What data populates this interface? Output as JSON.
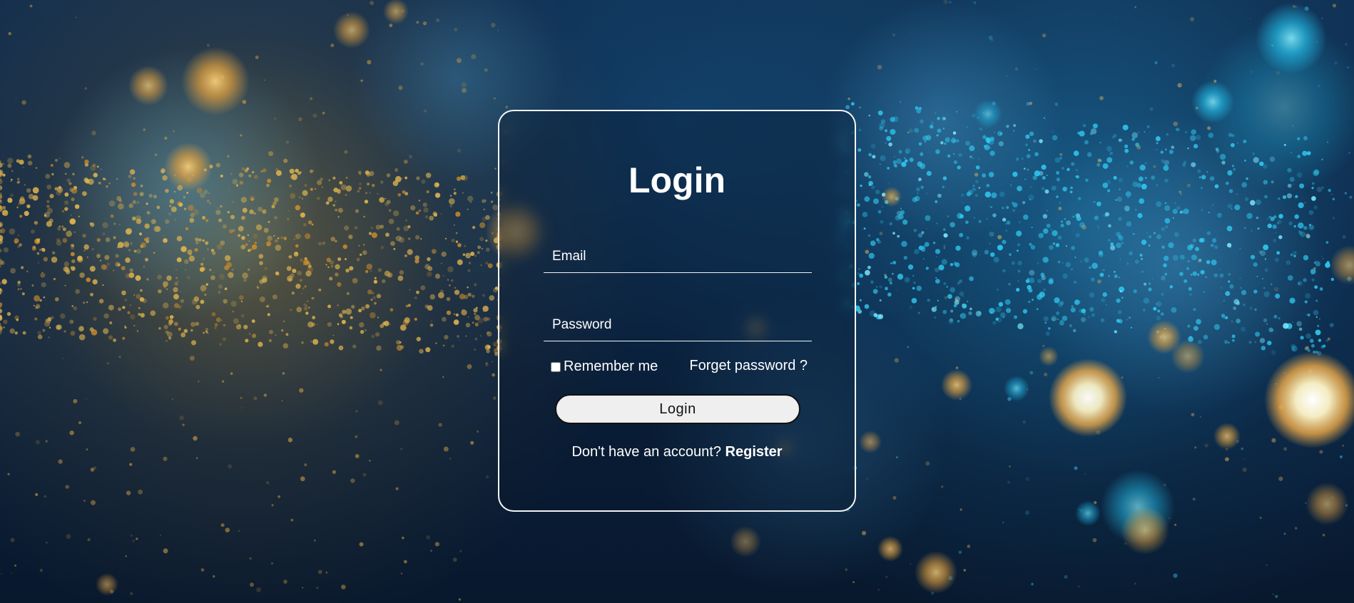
{
  "login": {
    "title": "Login",
    "email_placeholder": "Email",
    "password_placeholder": "Password",
    "remember_me_label": "Remember me",
    "remember_me_checked": false,
    "forgot_password_label": "Forget password ?",
    "submit_label": "Login",
    "register_prompt": "Don't have an account?",
    "register_label": "Register"
  },
  "colors": {
    "text": "#ffffff",
    "button_background": "#efefef",
    "button_text": "#111111",
    "card_border": "#ffffff",
    "background_primary": "#0b2342",
    "background_gold": "#d6a63a",
    "background_cyan": "#28aae6"
  }
}
